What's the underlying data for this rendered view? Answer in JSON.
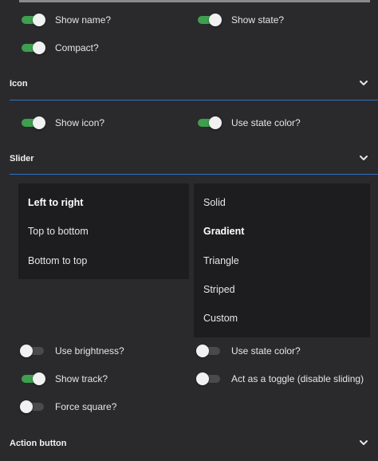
{
  "colors": {
    "accent": "#3e9f4e",
    "divider": "#2f6fc3",
    "background": "#2a2a2c",
    "listbox": "#1d1d1f"
  },
  "toggles": {
    "show_name": {
      "label": "Show name?",
      "on": true
    },
    "show_state": {
      "label": "Show state?",
      "on": true
    },
    "compact": {
      "label": "Compact?",
      "on": true
    },
    "show_icon": {
      "label": "Show icon?",
      "on": true
    },
    "icon_use_state_color": {
      "label": "Use state color?",
      "on": true
    },
    "use_brightness": {
      "label": "Use brightness?",
      "on": false
    },
    "slider_use_state_color": {
      "label": "Use state color?",
      "on": false
    },
    "show_track": {
      "label": "Show track?",
      "on": true
    },
    "act_as_toggle": {
      "label": "Act as a toggle (disable sliding)",
      "on": false
    },
    "force_square": {
      "label": "Force square?",
      "on": false
    }
  },
  "sections": {
    "icon": {
      "title": "Icon",
      "icon": "chevron-down-icon"
    },
    "slider": {
      "title": "Slider",
      "icon": "chevron-down-icon"
    },
    "action_button": {
      "title": "Action button",
      "icon": "chevron-down-icon"
    }
  },
  "direction_list": {
    "items": [
      "Left to right",
      "Top to bottom",
      "Bottom to top"
    ],
    "selected": "Left to right"
  },
  "style_list": {
    "items": [
      "Solid",
      "Gradient",
      "Triangle",
      "Striped",
      "Custom"
    ],
    "selected": "Gradient"
  }
}
